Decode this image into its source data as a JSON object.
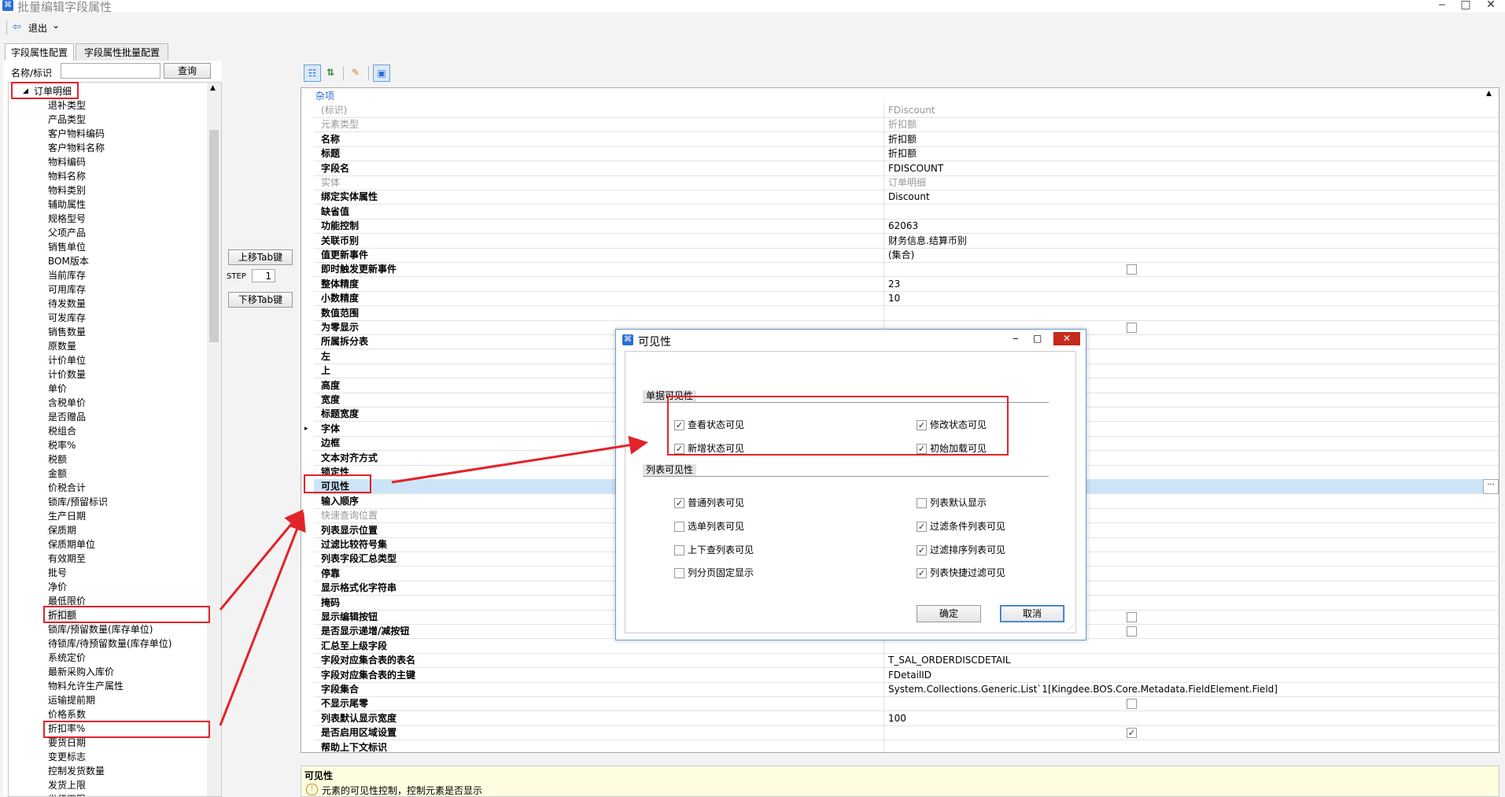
{
  "window": {
    "title": "批量编辑字段属性",
    "minimize": "‒",
    "maximize": "□",
    "close": "✕"
  },
  "toolbar": {
    "exit_label": "退出",
    "exit_dropdown": "⌄"
  },
  "tabs": [
    {
      "label": "字段属性配置"
    },
    {
      "label": "字段属性批量配置"
    }
  ],
  "search": {
    "label": "名称/标识",
    "value": "",
    "button": "查询"
  },
  "tree": {
    "root": "订单明细",
    "items": [
      "退补类型",
      "产品类型",
      "客户物料编码",
      "客户物料名称",
      "物料编码",
      "物料名称",
      "物料类别",
      "辅助属性",
      "规格型号",
      "父项产品",
      "销售单位",
      "BOM版本",
      "当前库存",
      "可用库存",
      "待发数量",
      "可发库存",
      "销售数量",
      "原数量",
      "计价单位",
      "计价数量",
      "单价",
      "含税单价",
      "是否赠品",
      "税组合",
      "税率%",
      "税额",
      "金额",
      "价税合计",
      "锁库/预留标识",
      "生产日期",
      "保质期",
      "保质期单位",
      "有效期至",
      "批号",
      "净价",
      "最低限价",
      "折扣额",
      "锁库/预留数量(库存单位)",
      "待锁库/待预留数量(库存单位)",
      "系统定价",
      "最新采购入库价",
      "物料允许生产属性",
      "运输提前期",
      "价格系数",
      "折扣率%",
      "要货日期",
      "变更标志",
      "控制发货数量",
      "发货上限",
      "发货下限"
    ]
  },
  "mid": {
    "up_button": "上移Tab键",
    "step_label": "STEP",
    "step_value": "1",
    "down_button": "下移Tab键"
  },
  "grid": {
    "category": "杂项",
    "rows": [
      {
        "name": "(标识)",
        "value": "FDiscount",
        "gray": true
      },
      {
        "name": "元素类型",
        "value": "折扣额",
        "gray": true
      },
      {
        "name": "名称",
        "value": "折扣额"
      },
      {
        "name": "标题",
        "value": "折扣额"
      },
      {
        "name": "字段名",
        "value": "FDISCOUNT"
      },
      {
        "name": "实体",
        "value": "订单明细",
        "gray": true
      },
      {
        "name": "绑定实体属性",
        "value": "Discount"
      },
      {
        "name": "缺省值",
        "value": ""
      },
      {
        "name": "功能控制",
        "value": "62063"
      },
      {
        "name": "关联币别",
        "value": "财务信息.结算币别"
      },
      {
        "name": "值更新事件",
        "value": "(集合)"
      },
      {
        "name": "即时触发更新事件",
        "value": "",
        "checkbox": true,
        "checked": false
      },
      {
        "name": "整体精度",
        "value": "23"
      },
      {
        "name": "小数精度",
        "value": "10"
      },
      {
        "name": "数值范围",
        "value": ""
      },
      {
        "name": "为零显示",
        "value": "",
        "checkbox": true,
        "checked": false
      },
      {
        "name": "所属拆分表",
        "value": ""
      },
      {
        "name": "左",
        "value": ""
      },
      {
        "name": "上",
        "value": ""
      },
      {
        "name": "高度",
        "value": ""
      },
      {
        "name": "宽度",
        "value": ""
      },
      {
        "name": "标题宽度",
        "value": ""
      },
      {
        "name": "字体",
        "value": "",
        "expander": "▸"
      },
      {
        "name": "边框",
        "value": ""
      },
      {
        "name": "文本对齐方式",
        "value": ""
      },
      {
        "name": "锁定性",
        "value": ""
      },
      {
        "name": "可见性",
        "value": "",
        "selected": true,
        "ellipsis": "···"
      },
      {
        "name": "输入顺序",
        "value": ""
      },
      {
        "name": "快速查询位置",
        "value": "",
        "gray": true
      },
      {
        "name": "列表显示位置",
        "value": ""
      },
      {
        "name": "过滤比较符号集",
        "value": ""
      },
      {
        "name": "列表字段汇总类型",
        "value": ""
      },
      {
        "name": "停靠",
        "value": ""
      },
      {
        "name": "显示格式化字符串",
        "value": ""
      },
      {
        "name": "掩码",
        "value": ""
      },
      {
        "name": "显示编辑按钮",
        "value": "",
        "checkbox": true,
        "checked": false
      },
      {
        "name": "是否显示递增/减按钮",
        "value": "",
        "checkbox": true,
        "checked": false
      },
      {
        "name": "汇总至上级字段",
        "value": ""
      },
      {
        "name": "字段对应集合表的表名",
        "value": "T_SAL_ORDERDISCDETAIL"
      },
      {
        "name": "字段对应集合表的主键",
        "value": "FDetailID"
      },
      {
        "name": "字段集合",
        "value": "System.Collections.Generic.List`1[Kingdee.BOS.Core.Metadata.FieldElement.Field]"
      },
      {
        "name": "不显示尾零",
        "value": "",
        "checkbox": true,
        "checked": false
      },
      {
        "name": "列表默认显示宽度",
        "value": "100"
      },
      {
        "name": "是否启用区域设置",
        "value": "",
        "checkbox": true,
        "checked": true
      },
      {
        "name": "帮助上下文标识",
        "value": ""
      }
    ]
  },
  "description": {
    "title": "可见性",
    "text": "元素的可见性控制，控制元素是否显示"
  },
  "dialog": {
    "title": "可见性",
    "section1": "单据可见性",
    "doc_items": [
      {
        "label": "查看状态可见",
        "checked": true
      },
      {
        "label": "修改状态可见",
        "checked": true
      },
      {
        "label": "新增状态可见",
        "checked": true
      },
      {
        "label": "初始加载可见",
        "checked": true
      }
    ],
    "section2": "列表可见性",
    "list_items": [
      {
        "label": "普通列表可见",
        "checked": true
      },
      {
        "label": "列表默认显示",
        "checked": false
      },
      {
        "label": "选单列表可见",
        "checked": false
      },
      {
        "label": "过滤条件列表可见",
        "checked": true
      },
      {
        "label": "上下查列表可见",
        "checked": false
      },
      {
        "label": "过滤排序列表可见",
        "checked": true
      },
      {
        "label": "列分页固定显示",
        "checked": false
      },
      {
        "label": "列表快捷过滤可见",
        "checked": true
      }
    ],
    "ok": "确定",
    "cancel": "取消"
  },
  "colors": {
    "annotation_red": "#e3222a",
    "selected_row": "#cce4f7",
    "accent": "#2c6fd6"
  }
}
